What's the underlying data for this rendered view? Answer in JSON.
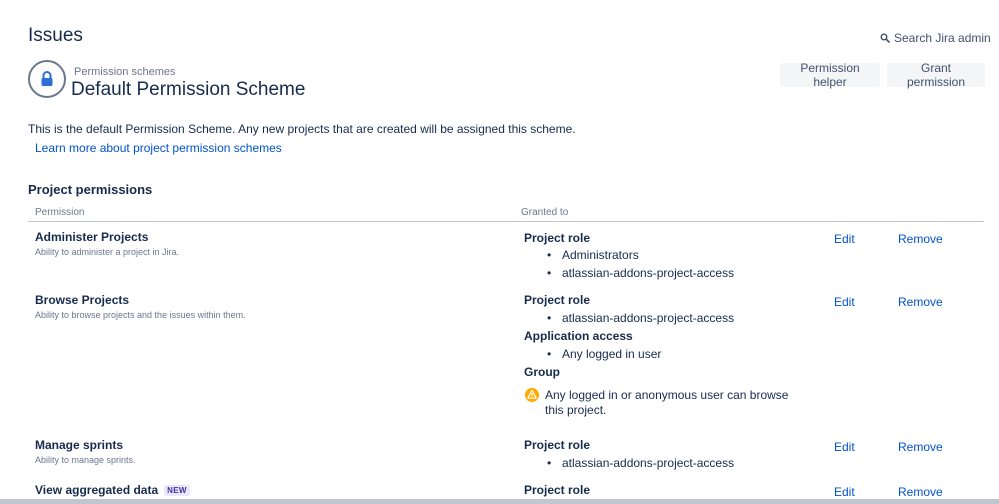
{
  "header": {
    "app_title": "Issues",
    "search_label": "Search Jira admin",
    "breadcrumb": "Permission schemes",
    "page_title": "Default Permission Scheme",
    "buttons": {
      "helper": "Permission helper",
      "grant": "Grant permission"
    }
  },
  "intro": {
    "description": "This is the default Permission Scheme. Any new projects that are created will be assigned this scheme.",
    "learn_more": "Learn more about project permission schemes"
  },
  "section": {
    "title": "Project permissions",
    "columns": {
      "permission": "Permission",
      "granted": "Granted to"
    }
  },
  "actions": {
    "edit": "Edit",
    "remove": "Remove"
  },
  "permissions": [
    {
      "name": "Administer Projects",
      "description": "Ability to administer a project in Jira.",
      "grants": [
        {
          "type": "Project role",
          "items": [
            "Administrators",
            "atlassian-addons-project-access"
          ]
        }
      ]
    },
    {
      "name": "Browse Projects",
      "description": "Ability to browse projects and the issues within them.",
      "grants": [
        {
          "type": "Project role",
          "items": [
            "atlassian-addons-project-access"
          ]
        },
        {
          "type": "Application access",
          "items": [
            "Any logged in user"
          ]
        },
        {
          "type": "Group",
          "warning": "Any logged in or anonymous user can browse this project."
        }
      ]
    },
    {
      "name": "Manage sprints",
      "description": "Ability to manage sprints.",
      "grants": [
        {
          "type": "Project role",
          "items": [
            "atlassian-addons-project-access"
          ]
        }
      ]
    },
    {
      "name": "View aggregated data",
      "badge": "NEW",
      "grants": [
        {
          "type": "Project role"
        }
      ]
    }
  ],
  "colors": {
    "link": "#0052cc",
    "text": "#172b4d",
    "muted": "#6b778c",
    "warning": "#ffab00"
  }
}
